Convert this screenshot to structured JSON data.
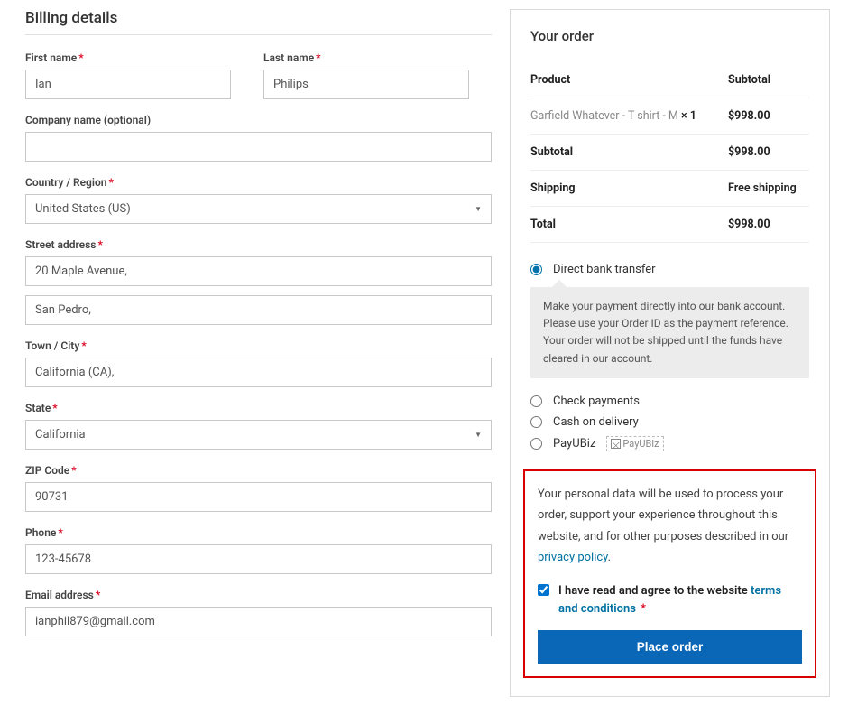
{
  "billing": {
    "title": "Billing details",
    "first_name_label": "First name",
    "first_name_value": "Ian",
    "last_name_label": "Last name",
    "last_name_value": "Philips",
    "company_label": "Company name (optional)",
    "company_value": "",
    "country_label": "Country / Region",
    "country_value": "United States (US)",
    "street_label": "Street address",
    "street1_value": "20 Maple Avenue,",
    "street2_value": "San Pedro,",
    "city_label": "Town / City",
    "city_value": "California (CA),",
    "state_label": "State",
    "state_value": "California",
    "zip_label": "ZIP Code",
    "zip_value": "90731",
    "phone_label": "Phone",
    "phone_value": "123-45678",
    "email_label": "Email address",
    "email_value": "ianphil879@gmail.com",
    "required_marker": "*"
  },
  "order": {
    "title": "Your order",
    "product_header": "Product",
    "subtotal_header": "Subtotal",
    "line_item_name": "Garfield Whatever - T shirt - M ",
    "line_item_qty": " × 1",
    "line_item_price": "$998.00",
    "subtotal_label": "Subtotal",
    "subtotal_value": "$998.00",
    "shipping_label": "Shipping",
    "shipping_value": "Free shipping",
    "total_label": "Total",
    "total_value": "$998.00"
  },
  "payment": {
    "direct_bank": "Direct bank transfer",
    "direct_bank_desc": "Make your payment directly into our bank account. Please use your Order ID as the payment reference. Your order will not be shipped until the funds have cleared in our account.",
    "check": "Check payments",
    "cod": "Cash on delivery",
    "payu": "PayUBiz",
    "payu_alt": "PayUBiz"
  },
  "privacy": {
    "text_part1": "Your personal data will be used to process your order, support your experience throughout this website, and for other purposes described in our ",
    "link_text": "privacy policy",
    "text_part2": ".",
    "terms_text1": "I have read and agree to the website ",
    "terms_link": "terms and conditions",
    "required_marker": "*",
    "place_order": "Place order"
  }
}
